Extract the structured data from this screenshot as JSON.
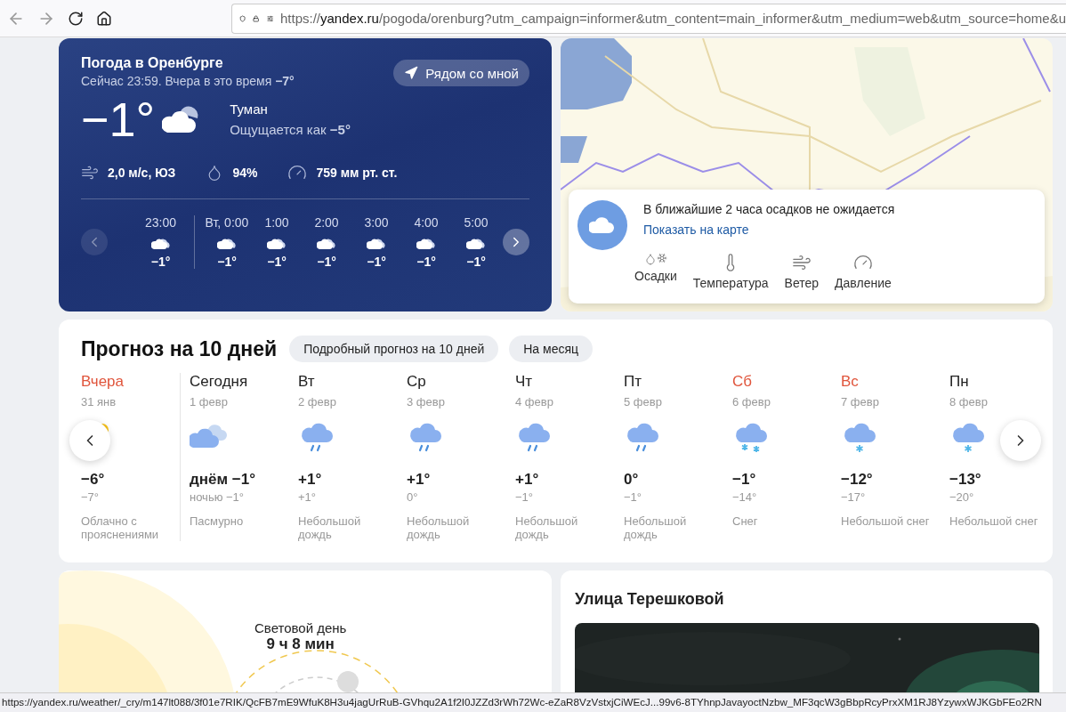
{
  "browser": {
    "url": {
      "scheme": "https://",
      "domain": "yandex.ru",
      "path": "/pogoda/orenburg?utm_campaign=informer&utm_content=main_informer&utm_medium=web&utm_source=home&u"
    }
  },
  "now": {
    "title": "Погода в Оренбурге",
    "subtitle": "Сейчас 23:59. Вчера в это время **−7°**",
    "nearby_button": "Рядом со мной",
    "temp": "−1°",
    "condition": "Туман",
    "feels": "Ощущается как **−5°**",
    "wind": "2,0 м/с, ЮЗ",
    "humidity": "94%",
    "pressure": "759 мм рт. ст.",
    "hours": [
      {
        "time": "23:00",
        "temp": "−1°",
        "divider_after": true
      },
      {
        "time": "Вт, 0:00",
        "temp": "−1°",
        "divider_after": false
      },
      {
        "time": "1:00",
        "temp": "−1°",
        "divider_after": false
      },
      {
        "time": "2:00",
        "temp": "−1°",
        "divider_after": false
      },
      {
        "time": "3:00",
        "temp": "−1°",
        "divider_after": false
      },
      {
        "time": "4:00",
        "temp": "−1°",
        "divider_after": false
      },
      {
        "time": "5:00",
        "temp": "−1°",
        "divider_after": false
      }
    ],
    "prev_disabled": true
  },
  "map": {
    "nowcast": "В ближайшие 2 часа осадков не ожидается",
    "link": "Показать на карте",
    "layers": [
      {
        "kind": "precip",
        "label": "Осадки"
      },
      {
        "kind": "temp",
        "label": "Температура"
      },
      {
        "kind": "wind",
        "label": "Ветер"
      },
      {
        "kind": "pressure",
        "label": "Давление"
      }
    ]
  },
  "forecast": {
    "title": "Прогноз на 10 дней",
    "buttons": [
      "Подробный прогноз на 10 дней",
      "На месяц"
    ],
    "days": [
      {
        "name": "Вчера",
        "date": "31 янв",
        "weekend": true,
        "kind": "partly_sunny",
        "day": "−6°",
        "night": "−7°",
        "text": "Облачно с прояснениями",
        "divider_after": true
      },
      {
        "name": "Сегодня",
        "date": "1 февр",
        "weekend": false,
        "kind": "cloudy",
        "day": "днём −1°",
        "night": "ночью −1°",
        "text": "Пасмурно",
        "divider_after": false
      },
      {
        "name": "Вт",
        "date": "2 февр",
        "weekend": false,
        "kind": "rain",
        "day": "+1°",
        "night": "+1°",
        "text": "Небольшой дождь",
        "divider_after": false
      },
      {
        "name": "Ср",
        "date": "3 февр",
        "weekend": false,
        "kind": "rain",
        "day": "+1°",
        "night": "0°",
        "text": "Небольшой дождь",
        "divider_after": false
      },
      {
        "name": "Чт",
        "date": "4 февр",
        "weekend": false,
        "kind": "rain",
        "day": "+1°",
        "night": "−1°",
        "text": "Небольшой дождь",
        "divider_after": false
      },
      {
        "name": "Пт",
        "date": "5 февр",
        "weekend": false,
        "kind": "rain",
        "day": "0°",
        "night": "−1°",
        "text": "Небольшой дождь",
        "divider_after": false
      },
      {
        "name": "Сб",
        "date": "6 февр",
        "weekend": true,
        "kind": "snow_heavy",
        "day": "−1°",
        "night": "−14°",
        "text": "Снег",
        "divider_after": false
      },
      {
        "name": "Вс",
        "date": "7 февр",
        "weekend": true,
        "kind": "snow",
        "day": "−12°",
        "night": "−17°",
        "text": "Небольшой снег",
        "divider_after": false
      },
      {
        "name": "Пн",
        "date": "8 февр",
        "weekend": false,
        "kind": "snow",
        "day": "−13°",
        "night": "−20°",
        "text": "Небольшой снег",
        "divider_after": false
      }
    ]
  },
  "daylight": {
    "label": "Световой день",
    "value": "9 ч 8 мин"
  },
  "street": {
    "title": "Улица Терешковой"
  },
  "status_bar": "https://yandex.ru/weather/_cry/m147lt088/3f01e7RIK/QcFB7mE9WfuK8H3u4jagUrRuB-GVhqu2A1f2I0JZZd3rWh72Wc-eZaR8VzVstxjCiWEcJ...99v6-8TYhnpJavayoctNzbw_MF3qcW3gBbpRcyPrxXM1RJ8YzywxWJKGbFEo2RN"
}
